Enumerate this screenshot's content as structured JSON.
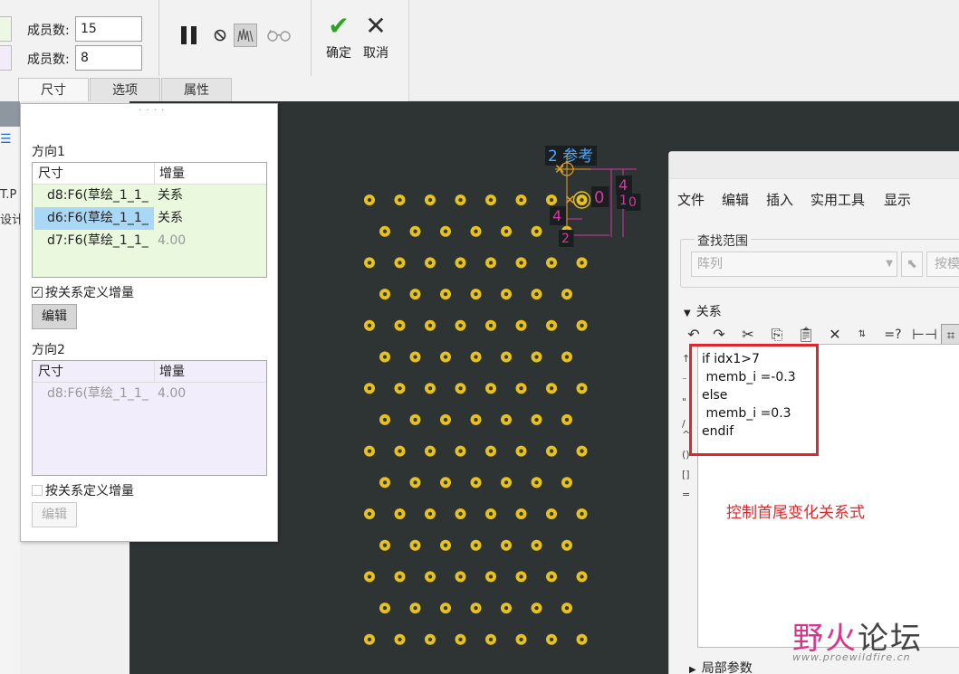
{
  "ribbon": {
    "member_count_label_1": "成员数:",
    "member_count_value_1": "15",
    "member_count_label_2": "成员数:",
    "member_count_value_2": "8",
    "confirm_label": "确定",
    "cancel_label": "取消",
    "tabs": [
      "尺寸",
      "选项",
      "属性"
    ]
  },
  "left_strip": {
    "frag_1": "T.P",
    "frag_2": "设计"
  },
  "dim_panel": {
    "dir1_title": "方向1",
    "dir1_headers": [
      "尺寸",
      "增量"
    ],
    "dir1_rows": [
      {
        "dim": "d8:F6(草绘_1_1_",
        "inc": "关系"
      },
      {
        "dim": "d6:F6(草绘_1_1_",
        "inc": "关系"
      },
      {
        "dim": "d7:F6(草绘_1_1_",
        "inc": "4.00"
      }
    ],
    "dir1_check_label": "按关系定义增量",
    "dir1_edit": "编辑",
    "dir2_title": "方向2",
    "dir2_headers": [
      "尺寸",
      "增量"
    ],
    "dir2_rows": [
      {
        "dim": "d8:F6(草绘_1_1_",
        "inc": "4.00"
      }
    ],
    "dir2_check_label": "按关系定义增量",
    "dir2_edit": "编辑"
  },
  "canvas": {
    "ref_label": "2 参考",
    "dim_labels": [
      "0",
      "4",
      "4",
      "1",
      "0",
      "2"
    ]
  },
  "relations_dialog": {
    "menu": [
      "文件",
      "编辑",
      "插入",
      "实用工具",
      "显示"
    ],
    "scope_title": "查找范围",
    "scope_value": "阵列",
    "scope_by_model": "按模",
    "relations_title": "关系",
    "gutter": [
      "↑",
      "⁻",
      "\"",
      "/",
      "^",
      "()",
      "[]",
      "="
    ],
    "code": [
      "if idx1>7",
      " memb_i =-0.3",
      "else",
      " memb_i =0.3",
      "endif"
    ],
    "local_params": "局部参数"
  },
  "annotation": {
    "text": "控制首尾变化关系式"
  },
  "watermark": {
    "title_1": "野火",
    "title_2": "论坛",
    "url": "www.proewildfire.cn"
  },
  "colors": {
    "accent_red": "#e0262a",
    "canvas_bg": "#2e3333",
    "hole_yellow": "#e8c21c",
    "selection_blue": "#a9d8f6"
  }
}
